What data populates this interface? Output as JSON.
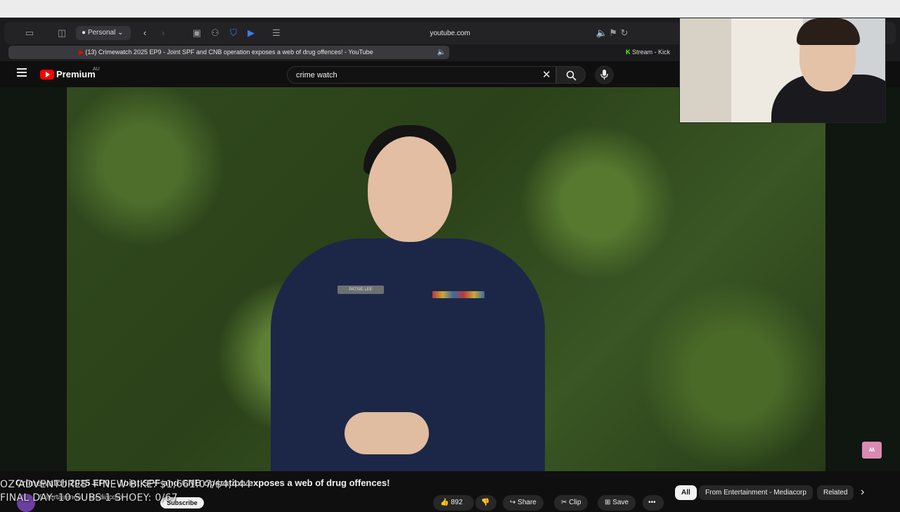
{
  "menubar": {
    "apple_icon": "apple-icon"
  },
  "browser": {
    "profile_label": "Personal",
    "url": "youtube.com",
    "active_tab_title": "(13) Crimewatch 2025 EP9 - Joint SPF and CNB operation exposes a web of drug offences! - YouTube",
    "second_tab_title": "Stream - Kick"
  },
  "youtube": {
    "logo_label": "Premium",
    "region_badge": "AU",
    "search_value": "crime watch",
    "video_title": "Crimewatch 2025 EP9 - Joint SPF and CNB operation exposes a web of drug offences!",
    "channel_name": "Entertainment - Mediacorp",
    "subscribe_label": "Subscribe",
    "likes": "892",
    "share_label": "Share",
    "clip_label": "Clip",
    "save_label": "Save",
    "chips": [
      "All",
      "From Entertainment - Mediacorp",
      "Related"
    ],
    "nametag": "PATSIE LEE"
  },
  "stream_overlay": {
    "line1": "OZ ADVENTURES + NEW BIKE: $1,661.07/$4,444",
    "line2": "FINAL DAY: 10 SUBS 1 SHOEY: 0/67"
  },
  "colors": {
    "youtube_red": "#ff0000",
    "background": "#0f0f0f",
    "chip_active": "#f1f1f1"
  }
}
